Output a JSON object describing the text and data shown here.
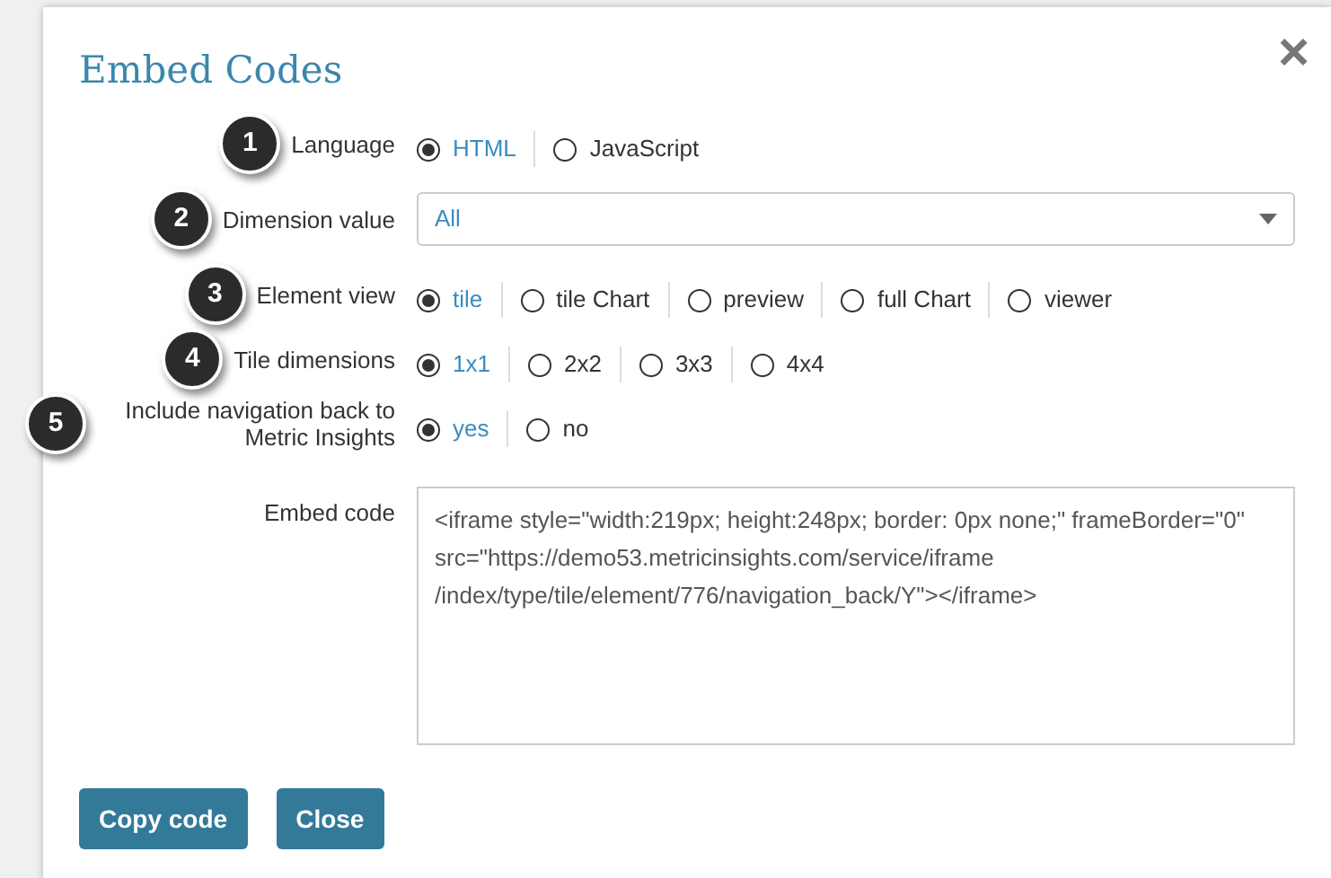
{
  "dialog": {
    "title": "Embed Codes",
    "close": "×"
  },
  "fields": [
    {
      "kind": "radio",
      "step": "1",
      "label": "Language",
      "options": [
        {
          "label": "HTML",
          "selected": true
        },
        {
          "label": "JavaScript",
          "selected": false
        }
      ]
    },
    {
      "kind": "select",
      "step": "2",
      "label": "Dimension value",
      "value": "All"
    },
    {
      "kind": "radio",
      "step": "3",
      "label": "Element view",
      "options": [
        {
          "label": "tile",
          "selected": true
        },
        {
          "label": "tile Chart",
          "selected": false
        },
        {
          "label": "preview",
          "selected": false
        },
        {
          "label": "full Chart",
          "selected": false
        },
        {
          "label": "viewer",
          "selected": false
        }
      ]
    },
    {
      "kind": "radio",
      "step": "4",
      "label": "Tile dimensions",
      "options": [
        {
          "label": "1x1",
          "selected": true
        },
        {
          "label": "2x2",
          "selected": false
        },
        {
          "label": "3x3",
          "selected": false
        },
        {
          "label": "4x4",
          "selected": false
        }
      ]
    },
    {
      "kind": "radio",
      "step": "5",
      "label": "Include navigation back to Metric Insights",
      "options": [
        {
          "label": "yes",
          "selected": true
        },
        {
          "label": "no",
          "selected": false
        }
      ]
    },
    {
      "kind": "textarea",
      "label": "Embed code",
      "value": "<iframe style=\"width:219px; height:248px; border: 0px none;\" frameBorder=\"0\" src=\"https://demo53.metricinsights.com/service/iframe /index/type/tile/element/776/navigation_back/Y\"></iframe>"
    }
  ],
  "buttons": [
    "Copy code",
    "Close"
  ]
}
